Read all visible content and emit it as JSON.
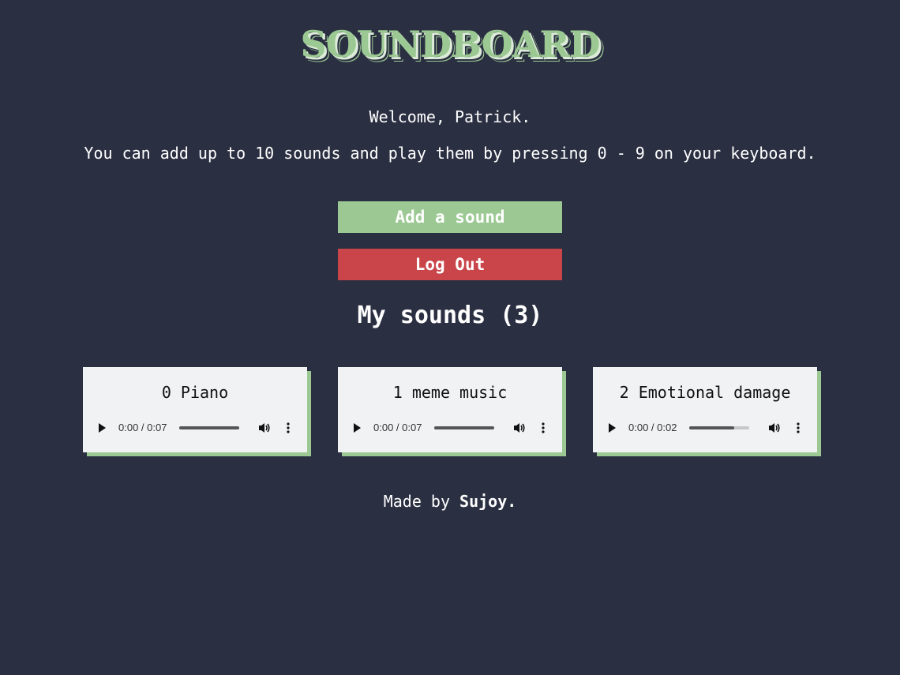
{
  "app": {
    "logo_text": "SOUNDBOARD",
    "welcome": "Welcome, Patrick.",
    "instructions": "You can add up to 10 sounds and play them by pressing 0 - 9 on your keyboard."
  },
  "actions": {
    "add_label": "Add a sound",
    "logout_label": "Log Out"
  },
  "sounds_section": {
    "title": "My sounds (3)",
    "sounds": [
      {
        "title": "0 Piano",
        "time": "0:00 / 0:07",
        "volume_level": 1.0
      },
      {
        "title": "1 meme music",
        "time": "0:00 / 0:07",
        "volume_level": 1.0
      },
      {
        "title": "2 Emotional damage",
        "time": "0:00 / 0:02",
        "volume_level": 0.75
      }
    ]
  },
  "footer": {
    "prefix": "Made by ",
    "author": "Sujoy."
  },
  "colors": {
    "background": "#2b2f42",
    "accent_green": "#9cc993",
    "danger_red": "#c9454a",
    "card_bg": "#f1f2f4"
  },
  "icons": [
    "play-icon",
    "volume-icon",
    "more-options-icon"
  ]
}
